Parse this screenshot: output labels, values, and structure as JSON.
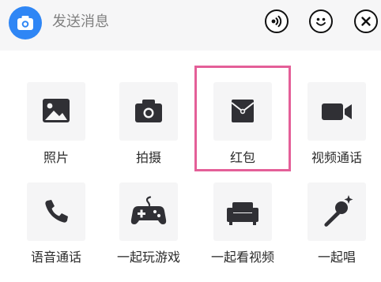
{
  "input_bar": {
    "placeholder": "发送消息",
    "camera_icon": "camera-icon",
    "voice_icon": "voice-icon",
    "emoji_icon": "emoji-icon",
    "close_icon": "close-icon"
  },
  "panel": {
    "items": [
      {
        "label": "照片",
        "icon": "photo-icon"
      },
      {
        "label": "拍摄",
        "icon": "camera-icon"
      },
      {
        "label": "红包",
        "icon": "red-packet-icon"
      },
      {
        "label": "视频通话",
        "icon": "video-call-icon"
      },
      {
        "label": "语音通话",
        "icon": "phone-icon"
      },
      {
        "label": "一起玩游戏",
        "icon": "gamepad-icon"
      },
      {
        "label": "一起看视频",
        "icon": "sofa-icon"
      },
      {
        "label": "一起唱",
        "icon": "microphone-icon"
      }
    ]
  },
  "colors": {
    "accent_blue": "#2f86f5",
    "highlight_pink": "#e45f98",
    "icon_dark": "#303035",
    "tile_bg": "#f5f5f6"
  }
}
